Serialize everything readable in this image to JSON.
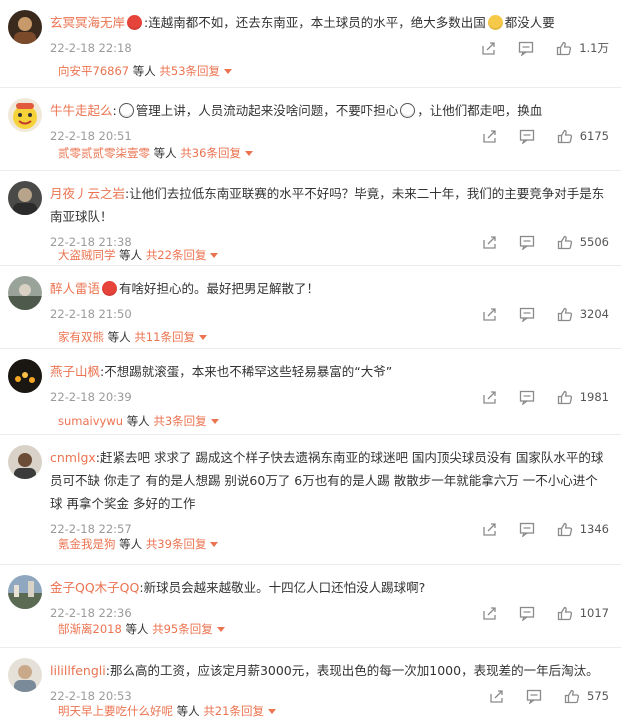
{
  "comments": [
    {
      "username": "玄冥冥海无岸",
      "text_a": ":连越南都不如，还去东南亚，本土球员的水平，绝大多数出国",
      "text_b": "都没人要",
      "emoji_mid": "laugh-cry-emoji",
      "emoji_lead": "angry-face-emoji",
      "time": "22-2-18 22:18",
      "likes": "1.1万",
      "reply_user": "向安平76867",
      "reply_joiner": "等人",
      "reply_count": "共53条回复"
    },
    {
      "username": "牛牛走起么",
      "text_a": "管理上讲，人员流动起来没啥问题，不要吓担心",
      "text_b": "，让他们都走吧，换血",
      "time": "22-2-18 20:51",
      "likes": "6175",
      "reply_user": "贰零贰贰零柒壹零",
      "reply_joiner": "等人",
      "reply_count": "共36条回复"
    },
    {
      "username": "月夜丿云之岩",
      "text_a": ":让他们去拉低东南亚联赛的水平不好吗？毕竟，未来二十年，我们的主要竞争对手是东南亚球队！",
      "time": "22-2-18 21:38",
      "likes": "5506",
      "reply_user": "大盗贼同学",
      "reply_joiner": "等人",
      "reply_count": "共22条回复"
    },
    {
      "username": "醉人雷语",
      "text_a": "有啥好担心的。最好把男足解散了！",
      "time": "22-2-18 21:50",
      "likes": "3204",
      "reply_user": "家有双熊",
      "reply_joiner": "等人",
      "reply_count": "共11条回复"
    },
    {
      "username": "燕子山枫",
      "text_a": ":不想踢就滚蛋，本来也不稀罕这些轻易暴富的“大爷”",
      "time": "22-2-18 20:39",
      "likes": "1981",
      "reply_user": "sumaivywu",
      "reply_joiner": "等人",
      "reply_count": "共3条回复"
    },
    {
      "username": "cnmlgx",
      "text_a": ":赶紧去吧  求求了  踢成这个样子快去遗祸东南亚的球迷吧  国内顶尖球员没有  国家队水平的球员可不缺  你走了  有的是人想踢  别说60万了  6万也有的是人踢  散散步一年就能拿六万  一不小心进个球  再拿个奖金  多好的工作",
      "time": "22-2-18 22:57",
      "likes": "1346",
      "reply_user": "氪金我是狗",
      "reply_joiner": "等人",
      "reply_count": "共39条回复"
    },
    {
      "username": "金子QQ木子QQ",
      "text_a": ":新球员会越来越敬业。十四亿人口还怕没人踢球啊?",
      "time": "22-2-18 22:36",
      "likes": "1017",
      "reply_user": "郜渐离2018",
      "reply_joiner": "等人",
      "reply_count": "共95条回复"
    },
    {
      "username": "lilillfengli",
      "text_a": ":那么高的工资，应该定月薪3000元，表现出色的每一次加1000，表现差的一年后淘汰。",
      "time": "22-2-18 20:53",
      "likes": "575",
      "reply_user": "明天早上要吃什么好呢",
      "reply_joiner": "等人",
      "reply_count": "共21条回复"
    }
  ],
  "colors": {
    "accent": "#eb7350",
    "text": "#333333",
    "muted": "#9a9a9a",
    "divider": "#ececec"
  }
}
